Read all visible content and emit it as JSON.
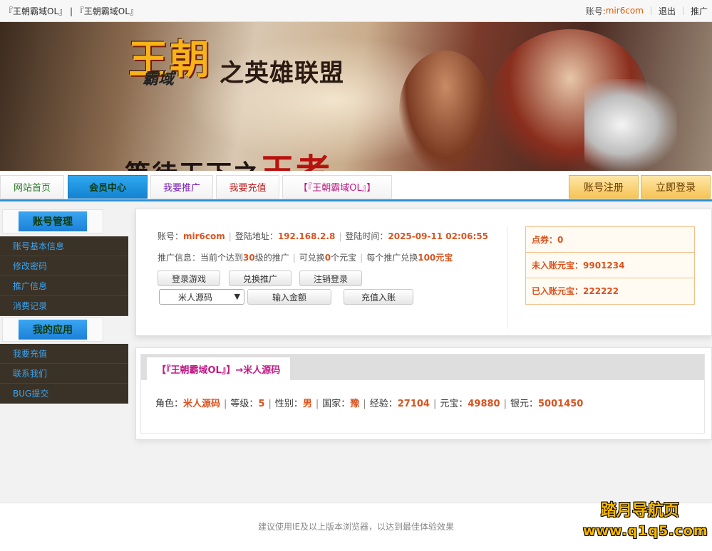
{
  "topbar": {
    "title": "『王朝霸域OL』 | 『王朝霸域OL』",
    "account_label": "账号:",
    "account_value": "mir6com",
    "logout": "退出",
    "promote": "推广"
  },
  "banner": {
    "logo": "王朝",
    "logo_sub": "霸域",
    "slogan": "之英雄联盟",
    "tagline": "等待天下之",
    "tagline_em": "王者"
  },
  "nav": {
    "tabs": [
      "网站首页",
      "会员中心",
      "我要推广",
      "我要充值",
      "【『王朝霸域OL』】"
    ],
    "register": "账号注册",
    "login": "立即登录",
    "colors": {
      "tab1": "#2a7a2a",
      "tab2": "#0b3a0b",
      "tab3": "#7a1ab8",
      "tab4": "#c01a1a",
      "tab5": "#c01a86"
    }
  },
  "sidebar": {
    "account_head": "账号管理",
    "account_items": [
      "账号基本信息",
      "修改密码",
      "推广信息",
      "消费记录"
    ],
    "app_head": "我的应用",
    "app_items": [
      "我要充值",
      "联系我们",
      "BUG提交"
    ]
  },
  "info": {
    "account_label": "账号：",
    "account": "mir6com",
    "login_addr_label": "登陆地址：",
    "login_addr": "192.168.2.8",
    "login_time_label": "登陆时间：",
    "login_time": "2025-09-11 02:06:55",
    "promo_prefix": "推广信息：当前个达到",
    "promo_level": "30",
    "promo_mid": "级的推广",
    "promo_exch_prefix": "可兑换",
    "promo_exch": "0",
    "promo_exch_suffix": "个元宝",
    "promo_each_prefix": "每个推广兑换",
    "promo_each": "100元宝",
    "buttons": {
      "login_game": "登录游戏",
      "exchange": "兑换推广",
      "logout": "注销登录",
      "input_amount": "输入金额",
      "recharge": "充值入账"
    },
    "select_value": "米人源码"
  },
  "stats": {
    "points_label": "点券：",
    "points": "0",
    "pending_label": "未入账元宝：",
    "pending": "9901234",
    "credited_label": "已入账元宝：",
    "credited": "222222"
  },
  "character": {
    "tab": "【『王朝霸域OL』】→米人源码",
    "role_label": "角色：",
    "role": "米人源码",
    "level_label": "等级：",
    "level": "5",
    "gender_label": "性别：",
    "gender": "男",
    "nation_label": "国家：",
    "nation": "豫",
    "exp_label": "经验：",
    "exp": "27104",
    "yb_label": "元宝：",
    "yb": "49880",
    "silver_label": "银元：",
    "silver": "5001450"
  },
  "footer": {
    "note": "建议使用IE及以上版本浏览器，以达到最佳体验效果",
    "watermark1": "踏月导航页",
    "watermark2": "www.q1q5.com"
  }
}
